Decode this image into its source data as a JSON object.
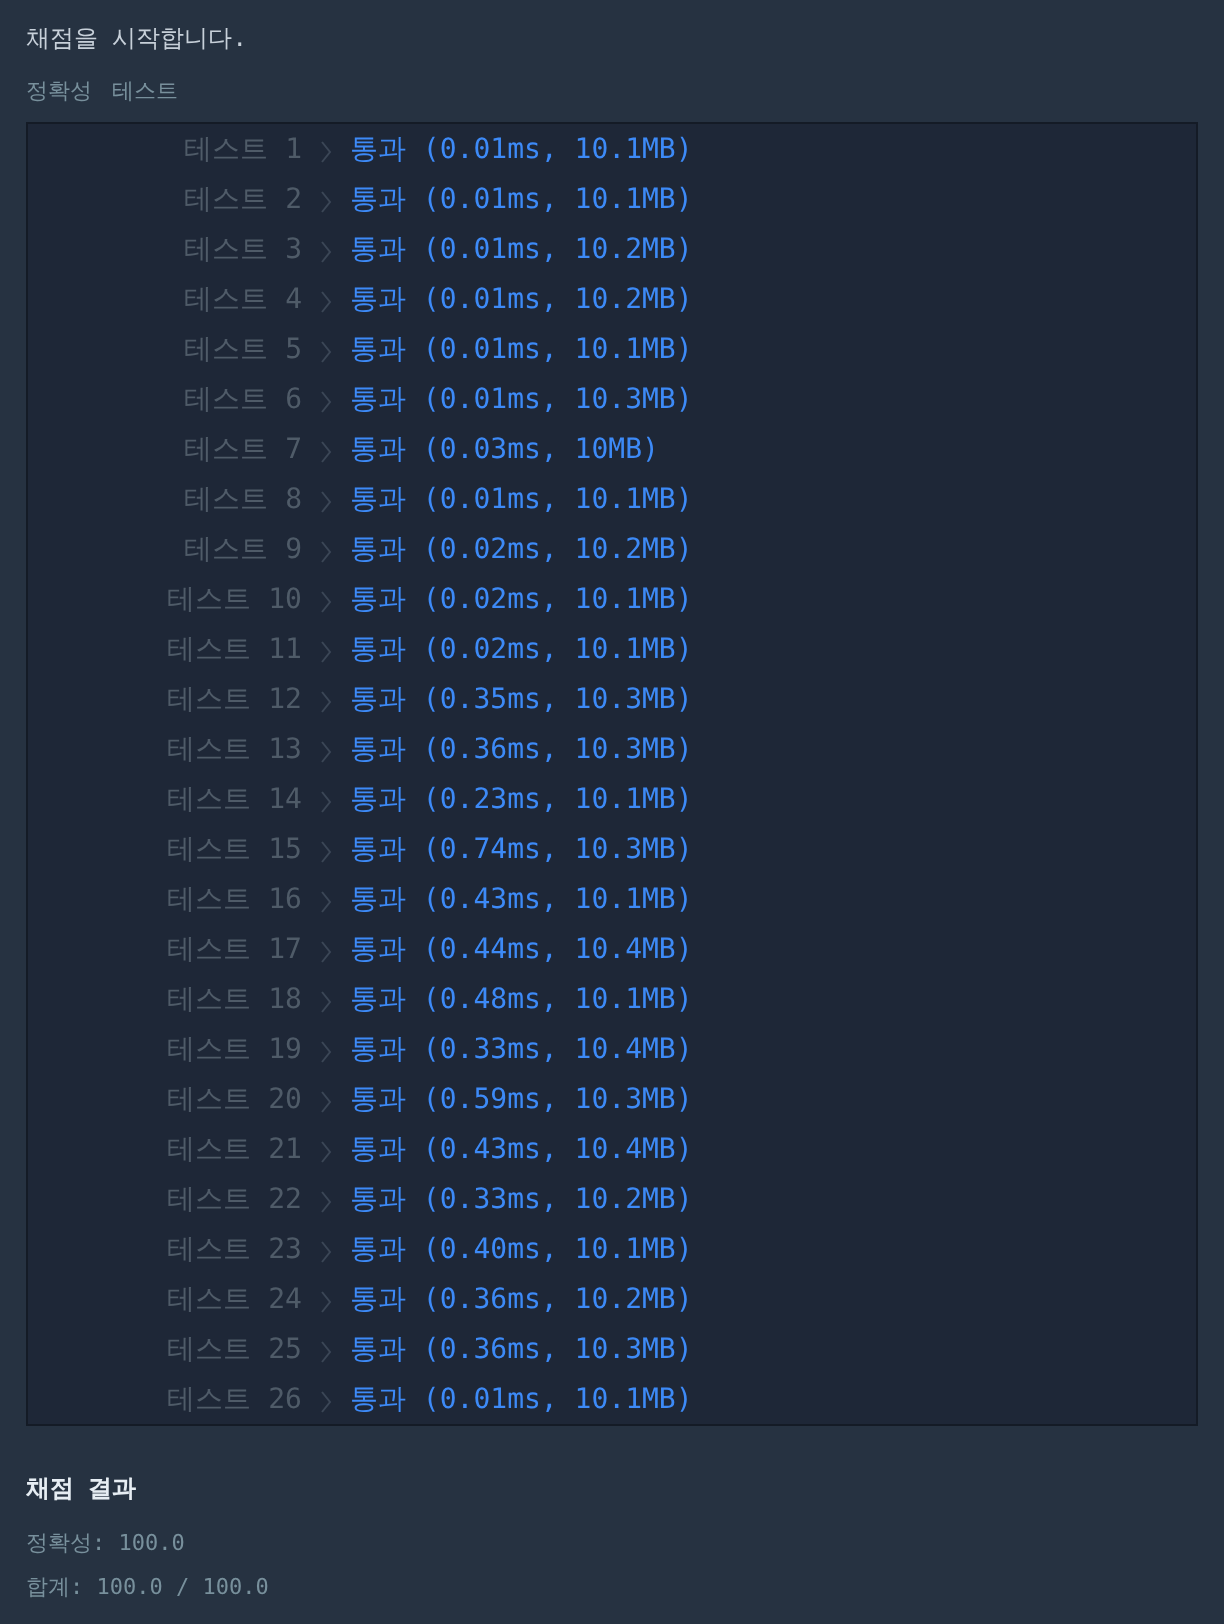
{
  "heading": "채점을 시작합니다.",
  "tabs": [
    {
      "label": "정확성",
      "selected": false
    },
    {
      "label": "테스트",
      "selected": false
    }
  ],
  "tests": [
    {
      "label": "테스트 1",
      "result": "통과 (0.01ms, 10.1MB)"
    },
    {
      "label": "테스트 2",
      "result": "통과 (0.01ms, 10.1MB)"
    },
    {
      "label": "테스트 3",
      "result": "통과 (0.01ms, 10.2MB)"
    },
    {
      "label": "테스트 4",
      "result": "통과 (0.01ms, 10.2MB)"
    },
    {
      "label": "테스트 5",
      "result": "통과 (0.01ms, 10.1MB)"
    },
    {
      "label": "테스트 6",
      "result": "통과 (0.01ms, 10.3MB)"
    },
    {
      "label": "테스트 7",
      "result": "통과 (0.03ms, 10MB)"
    },
    {
      "label": "테스트 8",
      "result": "통과 (0.01ms, 10.1MB)"
    },
    {
      "label": "테스트 9",
      "result": "통과 (0.02ms, 10.2MB)"
    },
    {
      "label": "테스트 10",
      "result": "통과 (0.02ms, 10.1MB)"
    },
    {
      "label": "테스트 11",
      "result": "통과 (0.02ms, 10.1MB)"
    },
    {
      "label": "테스트 12",
      "result": "통과 (0.35ms, 10.3MB)"
    },
    {
      "label": "테스트 13",
      "result": "통과 (0.36ms, 10.3MB)"
    },
    {
      "label": "테스트 14",
      "result": "통과 (0.23ms, 10.1MB)"
    },
    {
      "label": "테스트 15",
      "result": "통과 (0.74ms, 10.3MB)"
    },
    {
      "label": "테스트 16",
      "result": "통과 (0.43ms, 10.1MB)"
    },
    {
      "label": "테스트 17",
      "result": "통과 (0.44ms, 10.4MB)"
    },
    {
      "label": "테스트 18",
      "result": "통과 (0.48ms, 10.1MB)"
    },
    {
      "label": "테스트 19",
      "result": "통과 (0.33ms, 10.4MB)"
    },
    {
      "label": "테스트 20",
      "result": "통과 (0.59ms, 10.3MB)"
    },
    {
      "label": "테스트 21",
      "result": "통과 (0.43ms, 10.4MB)"
    },
    {
      "label": "테스트 22",
      "result": "통과 (0.33ms, 10.2MB)"
    },
    {
      "label": "테스트 23",
      "result": "통과 (0.40ms, 10.1MB)"
    },
    {
      "label": "테스트 24",
      "result": "통과 (0.36ms, 10.2MB)"
    },
    {
      "label": "테스트 25",
      "result": "통과 (0.36ms, 10.3MB)"
    },
    {
      "label": "테스트 26",
      "result": "통과 (0.01ms, 10.1MB)"
    }
  ],
  "summary": {
    "title": "채점 결과",
    "lines": [
      "정확성: 100.0",
      "합계: 100.0 / 100.0"
    ]
  }
}
